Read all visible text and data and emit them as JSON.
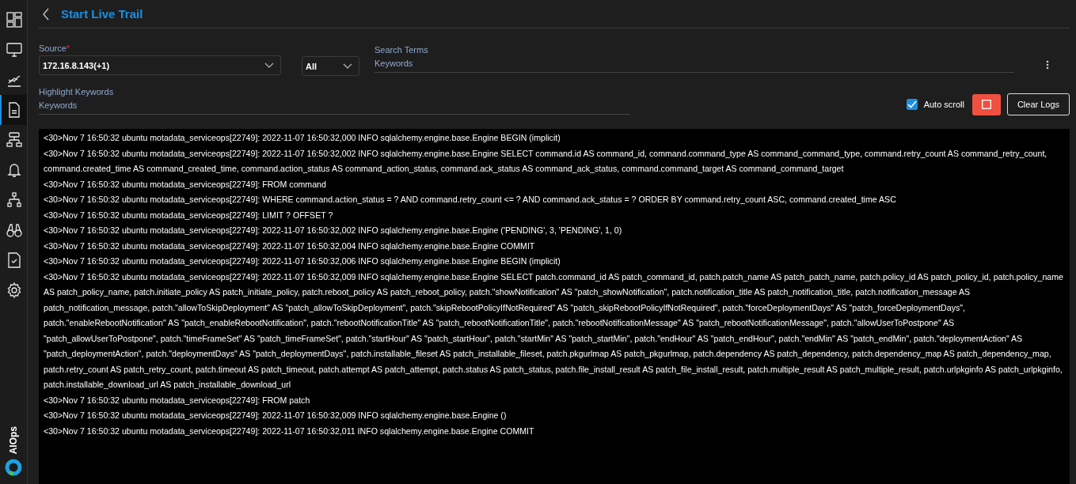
{
  "sidebar": {
    "items": [
      {
        "kind": "dashboard",
        "selected": false
      },
      {
        "kind": "monitor",
        "selected": false
      },
      {
        "kind": "chart",
        "selected": false
      },
      {
        "kind": "document",
        "selected": true
      },
      {
        "kind": "network",
        "selected": false
      },
      {
        "kind": "bell",
        "selected": false
      },
      {
        "kind": "hierarchy",
        "selected": false
      },
      {
        "kind": "binoculars",
        "selected": false
      },
      {
        "kind": "checklist",
        "selected": false
      },
      {
        "kind": "gear",
        "selected": false
      }
    ],
    "brand": "AIOps"
  },
  "header": {
    "title": "Start Live Trail"
  },
  "form": {
    "source": {
      "label": "Source",
      "required_mark": "*",
      "value": "172.16.8.143(+1)"
    },
    "filter": {
      "value": "All"
    },
    "search_terms": {
      "label": "Search Terms",
      "placeholder": "Keywords"
    },
    "highlight_keywords": {
      "label": "Highlight Keywords",
      "placeholder": "Keywords"
    }
  },
  "controls": {
    "auto_scroll": {
      "label": "Auto scroll",
      "checked": true
    },
    "clear_button": "Clear Logs"
  },
  "log_lines": [
    "<30>Nov 7 16:50:32 ubuntu motadata_serviceops[22749]: 2022-11-07 16:50:32,000 INFO sqlalchemy.engine.base.Engine BEGIN (implicit)",
    "<30>Nov 7 16:50:32 ubuntu motadata_serviceops[22749]: 2022-11-07 16:50:32,002 INFO sqlalchemy.engine.base.Engine SELECT command.id AS command_id, command.command_type AS command_command_type, command.retry_count AS command_retry_count, command.created_time AS command_created_time, command.action_status AS command_action_status, command.ack_status AS command_ack_status, command.command_target AS command_command_target",
    "<30>Nov 7 16:50:32 ubuntu motadata_serviceops[22749]: FROM command",
    "<30>Nov 7 16:50:32 ubuntu motadata_serviceops[22749]: WHERE command.action_status = ? AND command.retry_count <= ? AND command.ack_status = ? ORDER BY command.retry_count ASC, command.created_time ASC",
    "<30>Nov 7 16:50:32 ubuntu motadata_serviceops[22749]: LIMIT ? OFFSET ?",
    "<30>Nov 7 16:50:32 ubuntu motadata_serviceops[22749]: 2022-11-07 16:50:32,002 INFO sqlalchemy.engine.base.Engine ('PENDING', 3, 'PENDING', 1, 0)",
    "<30>Nov 7 16:50:32 ubuntu motadata_serviceops[22749]: 2022-11-07 16:50:32,004 INFO sqlalchemy.engine.base.Engine COMMIT",
    "<30>Nov 7 16:50:32 ubuntu motadata_serviceops[22749]: 2022-11-07 16:50:32,006 INFO sqlalchemy.engine.base.Engine BEGIN (implicit)",
    "<30>Nov 7 16:50:32 ubuntu motadata_serviceops[22749]: 2022-11-07 16:50:32,009 INFO sqlalchemy.engine.base.Engine SELECT patch.command_id AS patch_command_id, patch.patch_name AS patch_patch_name, patch.policy_id AS patch_policy_id, patch.policy_name AS patch_policy_name, patch.initiate_policy AS patch_initiate_policy, patch.reboot_policy AS patch_reboot_policy, patch.\"showNotification\" AS \"patch_showNotification\", patch.notification_title AS patch_notification_title, patch.notification_message AS patch_notification_message, patch.\"allowToSkipDeployment\" AS \"patch_allowToSkipDeployment\", patch.\"skipRebootPolicyIfNotRequired\" AS \"patch_skipRebootPolicyIfNotRequired\", patch.\"forceDeploymentDays\" AS \"patch_forceDeploymentDays\", patch.\"enableRebootNotification\" AS \"patch_enableRebootNotification\", patch.\"rebootNotificationTitle\" AS \"patch_rebootNotificationTitle\", patch.\"rebootNotificationMessage\" AS \"patch_rebootNotificationMessage\", patch.\"allowUserToPostpone\" AS \"patch_allowUserToPostpone\", patch.\"timeFrameSet\" AS \"patch_timeFrameSet\", patch.\"startHour\" AS \"patch_startHour\", patch.\"startMin\" AS \"patch_startMin\", patch.\"endHour\" AS \"patch_endHour\", patch.\"endMin\" AS \"patch_endMin\", patch.\"deploymentAction\" AS \"patch_deploymentAction\", patch.\"deploymentDays\" AS \"patch_deploymentDays\", patch.installable_fileset AS patch_installable_fileset, patch.pkgurlmap AS patch_pkgurlmap, patch.dependency AS patch_dependency, patch.dependency_map AS patch_dependency_map, patch.retry_count AS patch_retry_count, patch.timeout AS patch_timeout, patch.attempt AS patch_attempt, patch.status AS patch_status, patch.file_install_result AS patch_file_install_result, patch.multiple_result AS patch_multiple_result, patch.urlpkginfo AS patch_urlpkginfo, patch.installable_download_url AS patch_installable_download_url",
    "<30>Nov 7 16:50:32 ubuntu motadata_serviceops[22749]: FROM patch",
    "<30>Nov 7 16:50:32 ubuntu motadata_serviceops[22749]: 2022-11-07 16:50:32,009 INFO sqlalchemy.engine.base.Engine ()",
    "<30>Nov 7 16:50:32 ubuntu motadata_serviceops[22749]: 2022-11-07 16:50:32,011 INFO sqlalchemy.engine.base.Engine COMMIT"
  ]
}
